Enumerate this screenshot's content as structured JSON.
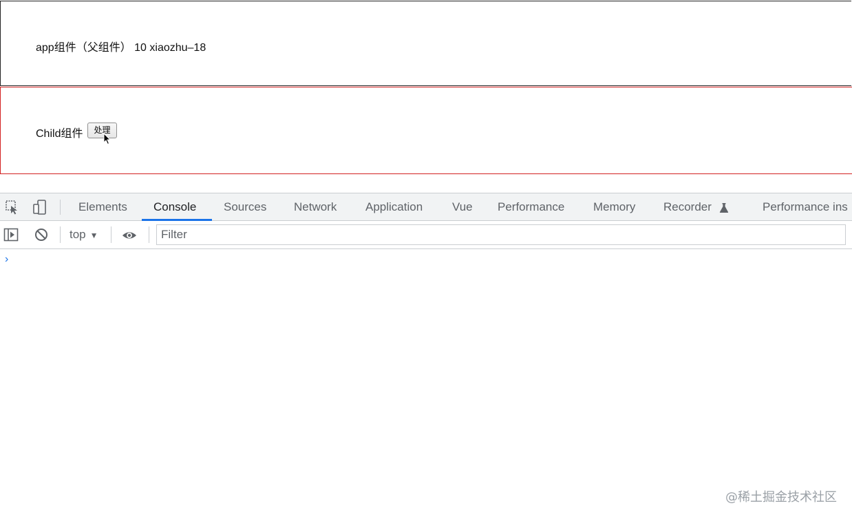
{
  "webpage": {
    "app_text": "app组件（父组件） 10 xiaozhu–18",
    "child_label": "Child组件",
    "child_button": "处理"
  },
  "devtools": {
    "tabs": [
      {
        "label": "Elements"
      },
      {
        "label": "Console",
        "active": true
      },
      {
        "label": "Sources"
      },
      {
        "label": "Network"
      },
      {
        "label": "Application"
      },
      {
        "label": "Vue"
      },
      {
        "label": "Performance"
      },
      {
        "label": "Memory"
      },
      {
        "label": "Recorder"
      },
      {
        "label": "Performance ins"
      }
    ],
    "toolbar": {
      "context": "top",
      "filter_placeholder": "Filter"
    },
    "console_prompt": "›",
    "accent_color": "#1a73e8"
  },
  "watermark": "@稀土掘金技术社区"
}
